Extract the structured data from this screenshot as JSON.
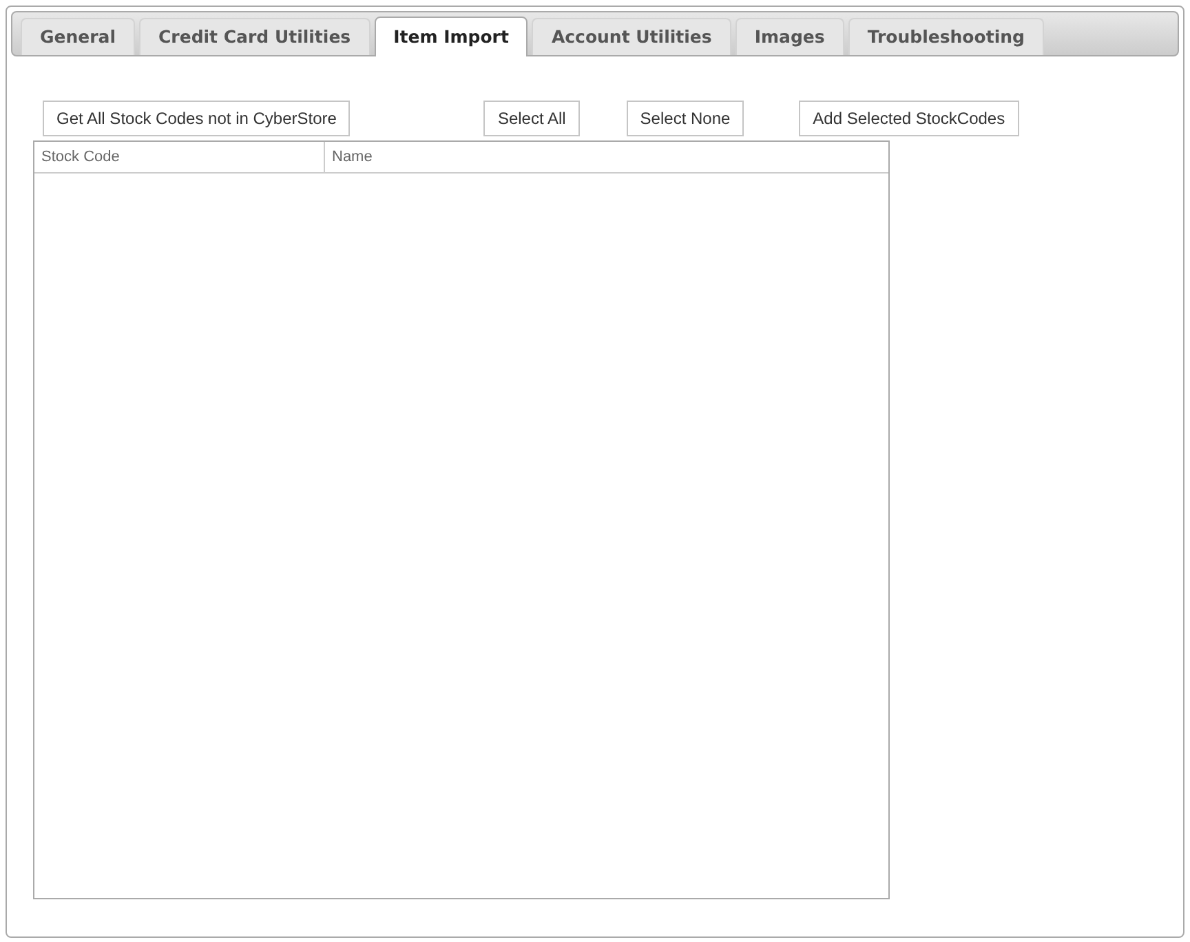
{
  "tabs": [
    {
      "label": "General",
      "selected": false
    },
    {
      "label": "Credit Card Utilities",
      "selected": false
    },
    {
      "label": "Item Import",
      "selected": true
    },
    {
      "label": "Account Utilities",
      "selected": false
    },
    {
      "label": "Images",
      "selected": false
    },
    {
      "label": "Troubleshooting",
      "selected": false
    }
  ],
  "buttons": [
    "Get All Stock Codes not in CyberStore",
    "Select All",
    "Select None",
    "Add Selected StockCodes"
  ],
  "table": {
    "columns": [
      "Stock Code",
      "Name"
    ]
  }
}
